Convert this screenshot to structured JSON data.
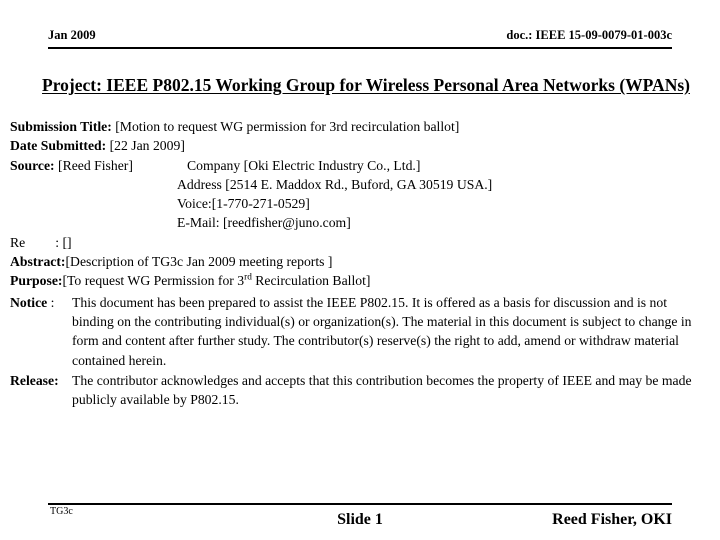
{
  "header": {
    "date": "Jan 2009",
    "doc_number": "doc.: IEEE 15-09-0079-01-003c"
  },
  "title": {
    "text": "Project: IEEE P802.15 Working Group for Wireless Personal Area Networks (WPANs)"
  },
  "fields": {
    "submission_title_label": "Submission Title:",
    "submission_title_value": "[Motion to request WG permission for 3rd recirculation ballot]",
    "date_submitted_label": "Date Submitted:",
    "date_submitted_value": "[22 Jan 2009]",
    "source_label": "Source:",
    "source_value": "[Reed Fisher]",
    "company_value": "Company [Oki Electric Industry Co., Ltd.]",
    "address_value": "Address [2514 E. Maddox Rd., Buford, GA 30519 USA.]",
    "voice_value": "Voice:[1-770-271-0529]",
    "email_value": "E-Mail: [reedfisher@juno.com]",
    "re_label": "Re",
    "re_value": ": []",
    "abstract_label": "Abstract:",
    "abstract_value": "[Description of TG3c Jan 2009 meeting reports ]",
    "purpose_label": "Purpose:",
    "purpose_value_pre": "[To request WG Permission for 3",
    "purpose_value_sup": "rd",
    "purpose_value_post": " Recirculation Ballot]"
  },
  "notice": {
    "label": "Notice",
    "colon": ":",
    "text": "This document has been prepared to assist the IEEE P802.15. It is offered as a basis for discussion and is not binding on the contributing individual(s) or organization(s). The material in this document is subject to change in form and content after further study. The contributor(s) reserve(s) the right to add, amend or withdraw material contained herein."
  },
  "release": {
    "label": "Release:",
    "text": "The contributor acknowledges and accepts that this contribution becomes the property of IEEE and may be made publicly available by P802.15."
  },
  "footer": {
    "left": "TG3c",
    "center": "Slide 1",
    "right": "Reed Fisher, OKI"
  }
}
